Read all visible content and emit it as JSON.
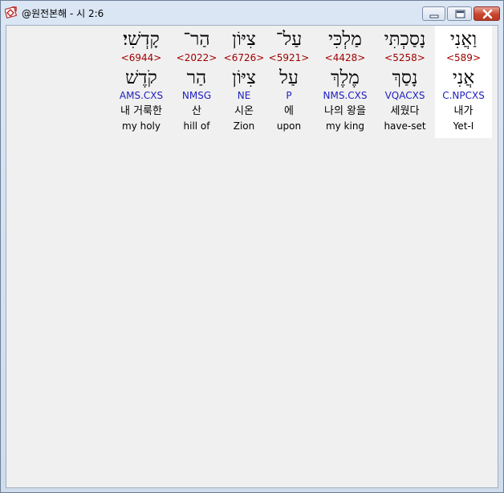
{
  "window": {
    "title": "@원전본해 - 시 2:6"
  },
  "words": [
    {
      "id": "w1",
      "hebrew": "וַאֲנִי",
      "strong": "<589>",
      "root": "אֲנִי",
      "morph": "C.NPCXS",
      "korean": "내가",
      "english": "Yet-I",
      "highlight": true
    },
    {
      "id": "w2",
      "hebrew": "נָסַכְתִּי",
      "strong": "<5258>",
      "root": "נָסַךְ",
      "morph": "VQACXS",
      "korean": "세웠다",
      "english": "have-set",
      "highlight": false
    },
    {
      "id": "w3",
      "hebrew": "מַלְכִּי",
      "strong": "<4428>",
      "root": "מֶלֶךְ",
      "morph": "NMS.CXS",
      "korean": "나의 왕을",
      "english": "my king",
      "highlight": false
    },
    {
      "id": "w4",
      "hebrew": "עַל־",
      "strong": "<5921>",
      "root": "עַל",
      "morph": "P",
      "korean": "에",
      "english": "upon",
      "highlight": false
    },
    {
      "id": "w5",
      "hebrew": "צִיּוֹן",
      "strong": "<6726>",
      "root": "צִיּוֹן",
      "morph": "NE",
      "korean": "시온",
      "english": "Zion",
      "highlight": false
    },
    {
      "id": "w6",
      "hebrew": "הַר־",
      "strong": "<2022>",
      "root": "הַר",
      "morph": "NMSG",
      "korean": "산",
      "english": "hill of",
      "highlight": false
    },
    {
      "id": "w7",
      "hebrew": "קָדְשִׁי׃",
      "strong": "<6944>",
      "root": "קֹדֶשׁ",
      "morph": "AMS.CXS",
      "korean": "내 거룩한",
      "english": "my holy",
      "highlight": false
    }
  ]
}
